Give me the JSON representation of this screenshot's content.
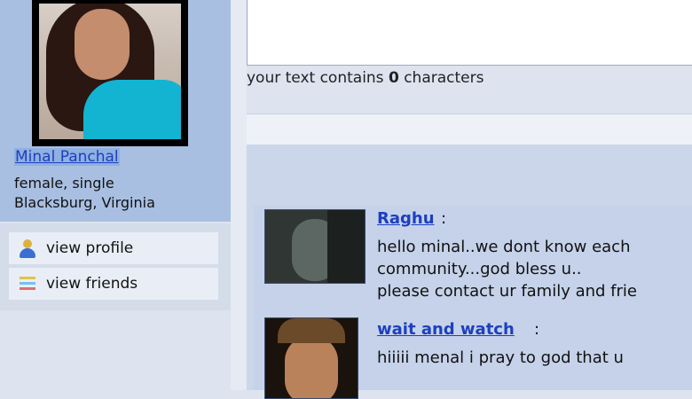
{
  "profile": {
    "name": "Minal Panchal",
    "gender_status": "female, single",
    "location": "Blacksburg, Virginia"
  },
  "nav": {
    "view_profile": "view profile",
    "view_friends": "view friends"
  },
  "composer": {
    "char_count_prefix": "your text contains",
    "char_count_value": "0",
    "char_count_suffix": "characters"
  },
  "scraps": [
    {
      "author": "Raghu",
      "lines": [
        "hello minal..we dont know each",
        "community...god bless u..",
        "please contact ur family and frie"
      ]
    },
    {
      "author": "wait and watch",
      "lines": [
        "hiiiii menal i pray to god that u"
      ]
    }
  ],
  "colors": {
    "link": "#1d3fbf",
    "left_panel": "#a9bfe2",
    "shirt": "#12b4d2"
  },
  "icons": {
    "view_profile": "person-icon",
    "view_friends": "friends-list-icon"
  }
}
